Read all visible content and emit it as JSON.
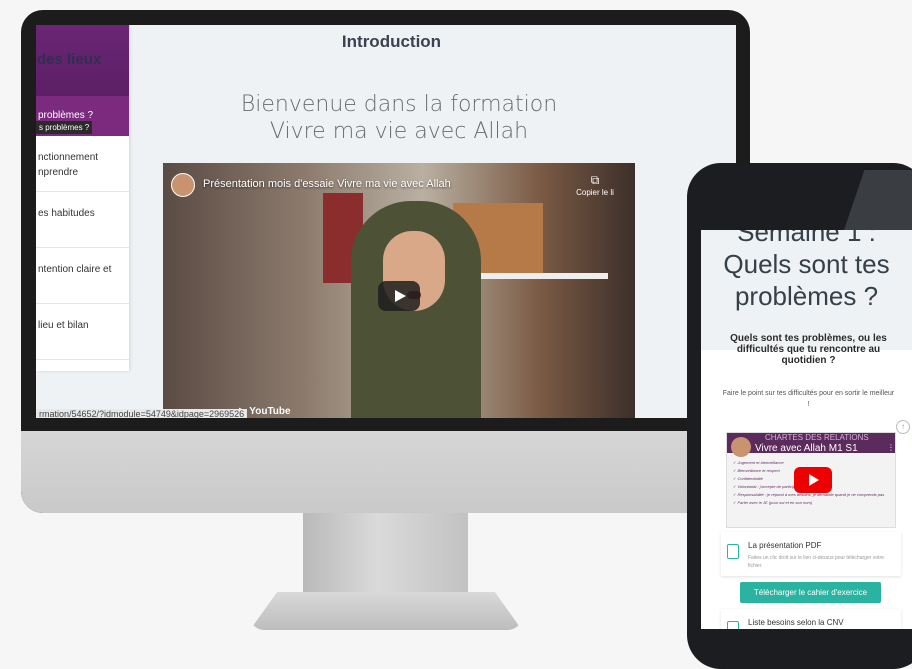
{
  "desktop": {
    "sidebar": {
      "header": "des lieux",
      "active_item": "problèmes ?",
      "active_subtooltip": "s problèmes ?",
      "items": [
        {
          "label": "nctionnement\nnprendre"
        },
        {
          "label": "es habitudes"
        },
        {
          "label": "ntention claire et"
        },
        {
          "label": "lieu et bilan"
        }
      ]
    },
    "page_heading": "Introduction",
    "welcome_line1": "Bienvenue dans la formation",
    "welcome_line2": "Vivre ma vie avec Allah",
    "video": {
      "title": "Présentation mois d'essaie Vivre ma vie avec Allah",
      "copy_label": "Copier le li",
      "logo": "YouTube"
    },
    "url_fragment": "rmation/54652/?idmodule=54749&idpage=2969526"
  },
  "phone": {
    "week_title_line1": "Semaine 1 :",
    "week_title_line2": "Quels sont tes",
    "week_title_line3": "problèmes ?",
    "question": "Quels sont tes problèmes, ou les difficultés que tu rencontre au quotidien ?",
    "intro_text": "Faire le point sur tes difficultés pour en sortir le meilleur !",
    "video": {
      "title": "Vivre avec Allah M1 S1",
      "overlay_title": "CHARTES DES RELATIONS",
      "lines": [
        "✓ Jugement et bienveillance",
        "✓ Bienveillance et respect",
        "✓ Confidentialité",
        "✓ Volontariat : j'accepte de participer",
        "✓ Responsabilité : je répond à mes besoins, je demande quand je ne comprends pas",
        "✓ Parler avec le JE (pour soi et en son nom)"
      ]
    },
    "file1": {
      "title": "La présentation PDF",
      "desc": "Faites un clic droit sur le lien ci-dessus pour télécharger votre fichier."
    },
    "download_button": "Télécharger le cahier d'exercice",
    "file2": {
      "title": "Liste besoins selon la CNV"
    },
    "scroll_top_icon": "↑"
  },
  "colors": {
    "purple": "#6a2470",
    "teal": "#2bb3a1",
    "youtube_red": "#ee0000"
  }
}
